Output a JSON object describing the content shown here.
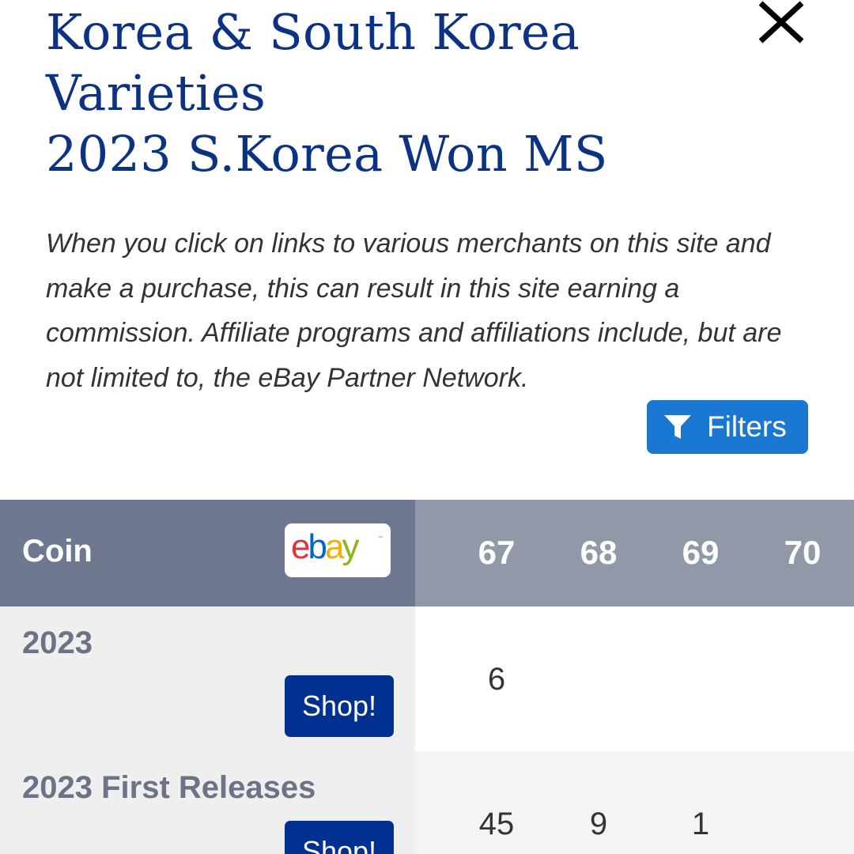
{
  "header": {
    "title_lines": [
      "Korea & South Korea",
      "Varieties",
      "2023 S.Korea Won MS"
    ]
  },
  "disclaimer": "When you click on links to various merchants on this site and make a purchase, this can result in this site earning a commission. Affiliate programs and affiliations include, but are not limited to, the eBay Partner Network.",
  "filters": {
    "label": "Filters"
  },
  "table": {
    "coin_header": "Coin",
    "ebay_logo": "ebay",
    "grades": [
      "67",
      "68",
      "69",
      "70"
    ],
    "rows": [
      {
        "coin": "2023",
        "shop_label": "Shop!",
        "values": [
          "6",
          "",
          "",
          ""
        ]
      },
      {
        "coin": "2023 First Releases",
        "shop_label": "Shop!",
        "values": [
          "45",
          "9",
          "1",
          ""
        ]
      }
    ]
  },
  "colors": {
    "title": "#0c3283",
    "filters_button": "#1a78d2",
    "shop_button": "#003090",
    "coin_header_bg": "#6e7890",
    "grade_header_bg": "#9199a9",
    "coin_cell_bg": "#efefef"
  },
  "icons": {
    "close": "close-icon",
    "filter": "funnel-icon"
  }
}
